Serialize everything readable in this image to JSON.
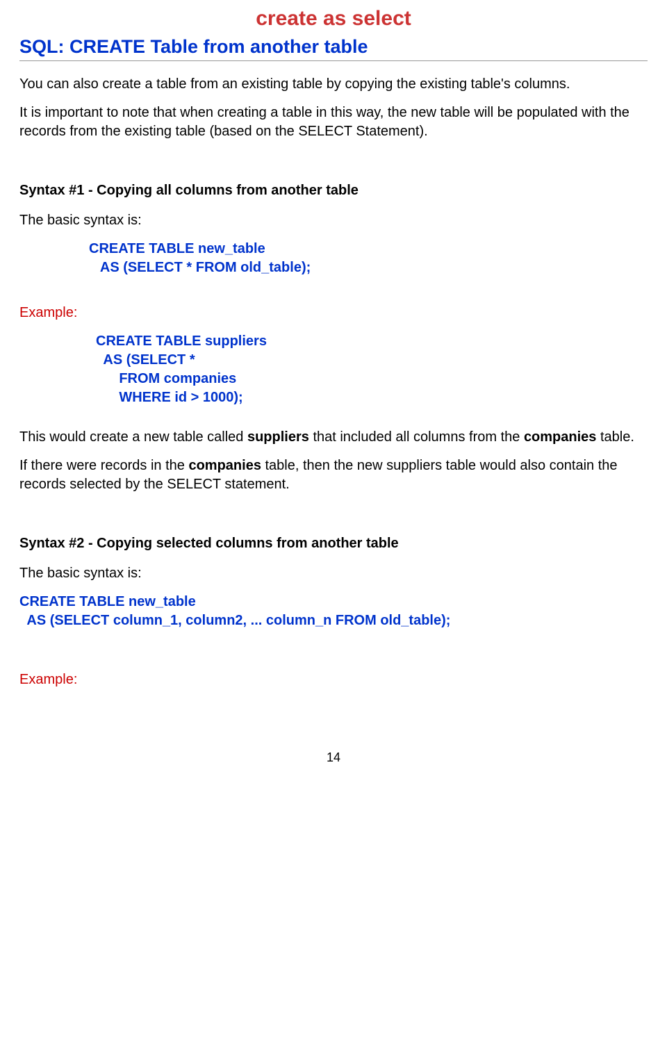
{
  "title": "create as select",
  "subtitle": "SQL: CREATE Table from another table",
  "intro1": "You can also create a table from an existing table by copying the existing table's columns.",
  "intro2": "It is important to note that when creating a table in this way, the new table will be populated with the records from the existing table (based on the SELECT Statement).",
  "syntax1": {
    "heading": "Syntax #1 - Copying all columns from another table",
    "lead": "The basic syntax is:",
    "code": "CREATE TABLE new_table\n   AS (SELECT * FROM old_table);",
    "exampleLabel": "Example:",
    "exampleCode": "CREATE TABLE suppliers\n  AS (SELECT *\n      FROM companies\n      WHERE id > 1000);",
    "result1_a": "This would create a new table called ",
    "result1_b": "suppliers",
    "result1_c": " that included all columns from the ",
    "result1_d": "companies",
    "result1_e": " table.",
    "result2_a": "If there were records in the ",
    "result2_b": "companies",
    "result2_c": " table, then the new suppliers table would also contain the records selected by the SELECT statement."
  },
  "syntax2": {
    "heading": "Syntax #2 - Copying selected columns from another table",
    "lead": "The basic syntax is:",
    "code": "CREATE TABLE new_table\n  AS (SELECT column_1, column2, ... column_n FROM old_table);",
    "exampleLabel": "Example:"
  },
  "pageNumber": "14"
}
